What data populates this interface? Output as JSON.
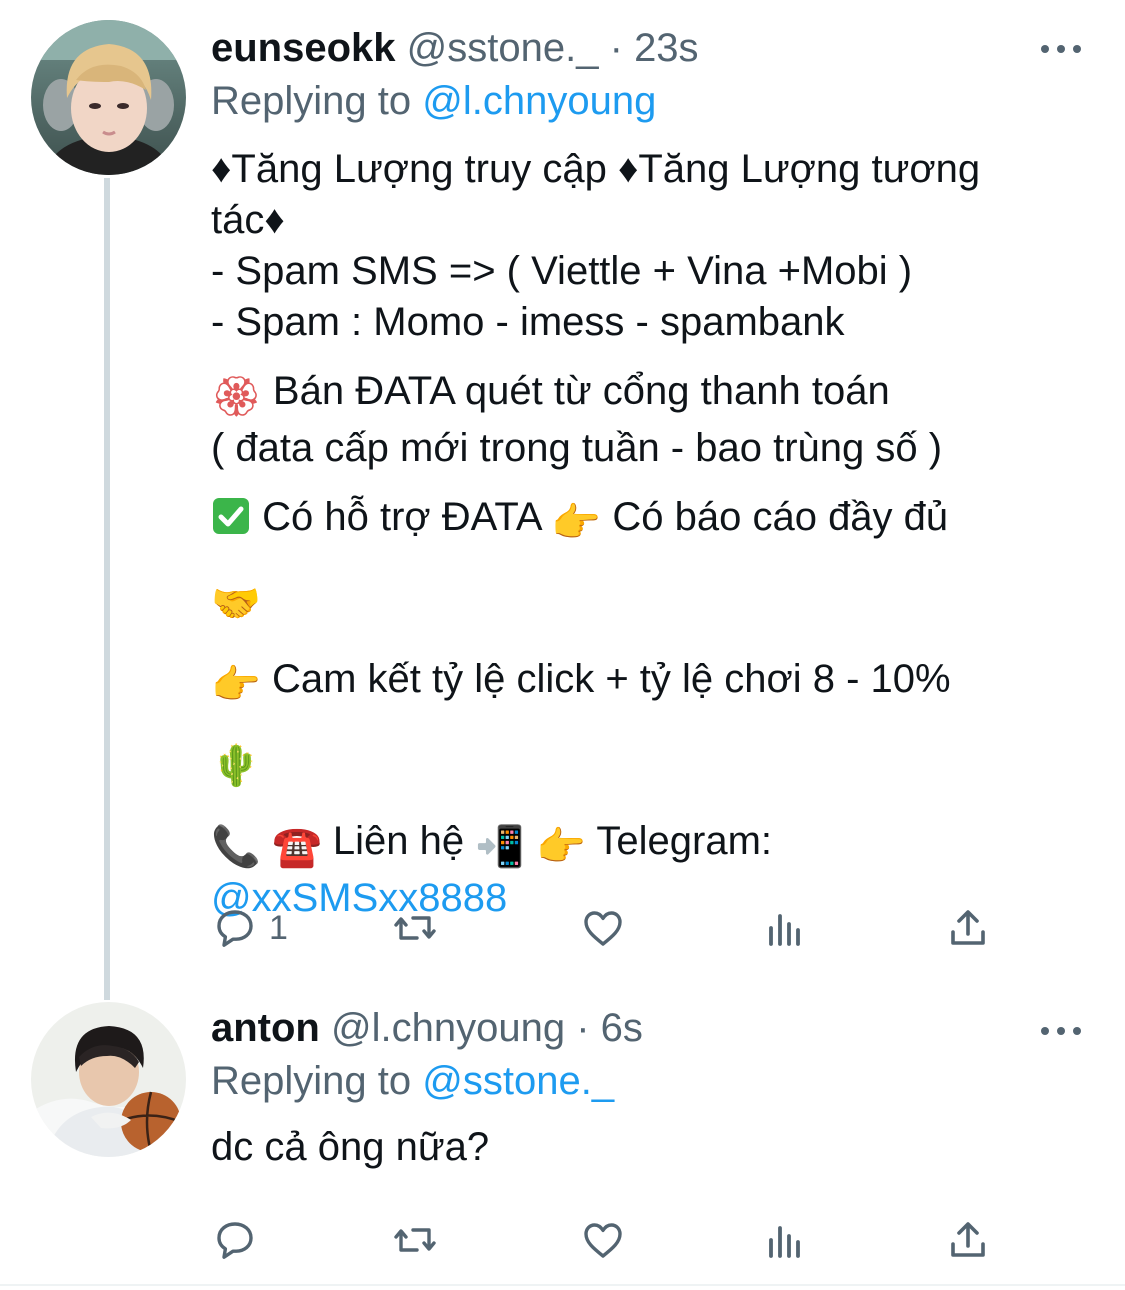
{
  "tweets": [
    {
      "name": "eunseokk",
      "handle": "@sstone._",
      "separator": "·",
      "time": "23s",
      "replying_prefix": "Replying to",
      "replying_to": "@l.chnyoung",
      "text": {
        "line1a": "♦Tăng Lượng truy cập ♦Tăng Lượng tương",
        "line1b": "tác♦",
        "line2": "- Spam SMS => ( Viettle + Vina +Mobi )",
        "line3": "- Spam : Momo - imess - spambank",
        "line4": "Bán ĐATA quét từ cổng thanh toán",
        "line5": "( đata cấp mới trong tuần - bao trùng số )",
        "line6a": "Có hỗ trợ ĐATA",
        "line6b": "Có báo cáo đầy đủ",
        "line8": "Cam kết tỷ lệ click + tỷ lệ chơi 8 - 10%",
        "line10": "Liên hệ",
        "line10b": "Telegram:",
        "telegram": "@xxSMSxx8888"
      },
      "emoji": {
        "flower": "🏵",
        "check": "✅",
        "point": "👉",
        "handshake": "🤝",
        "cactus": "🌵",
        "phone": "📞",
        "telephone": "☎️",
        "mobile": "📲"
      },
      "reply_count": "1"
    },
    {
      "name": "anton",
      "handle": "@l.chnyoung",
      "separator": "·",
      "time": "6s",
      "replying_prefix": "Replying to",
      "replying_to": "@sstone._",
      "text": "dc cả ông nữa?"
    }
  ],
  "icons": [
    "more-icon",
    "reply-icon",
    "retweet-icon",
    "like-icon",
    "views-icon",
    "share-icon"
  ],
  "colors": {
    "link": "#1d9bf0",
    "secondary_text": "#536471",
    "primary_text": "#0f1419",
    "thread_line": "#cfd9de",
    "check_green": "#3bb54a",
    "phone_red": "#c62828"
  }
}
